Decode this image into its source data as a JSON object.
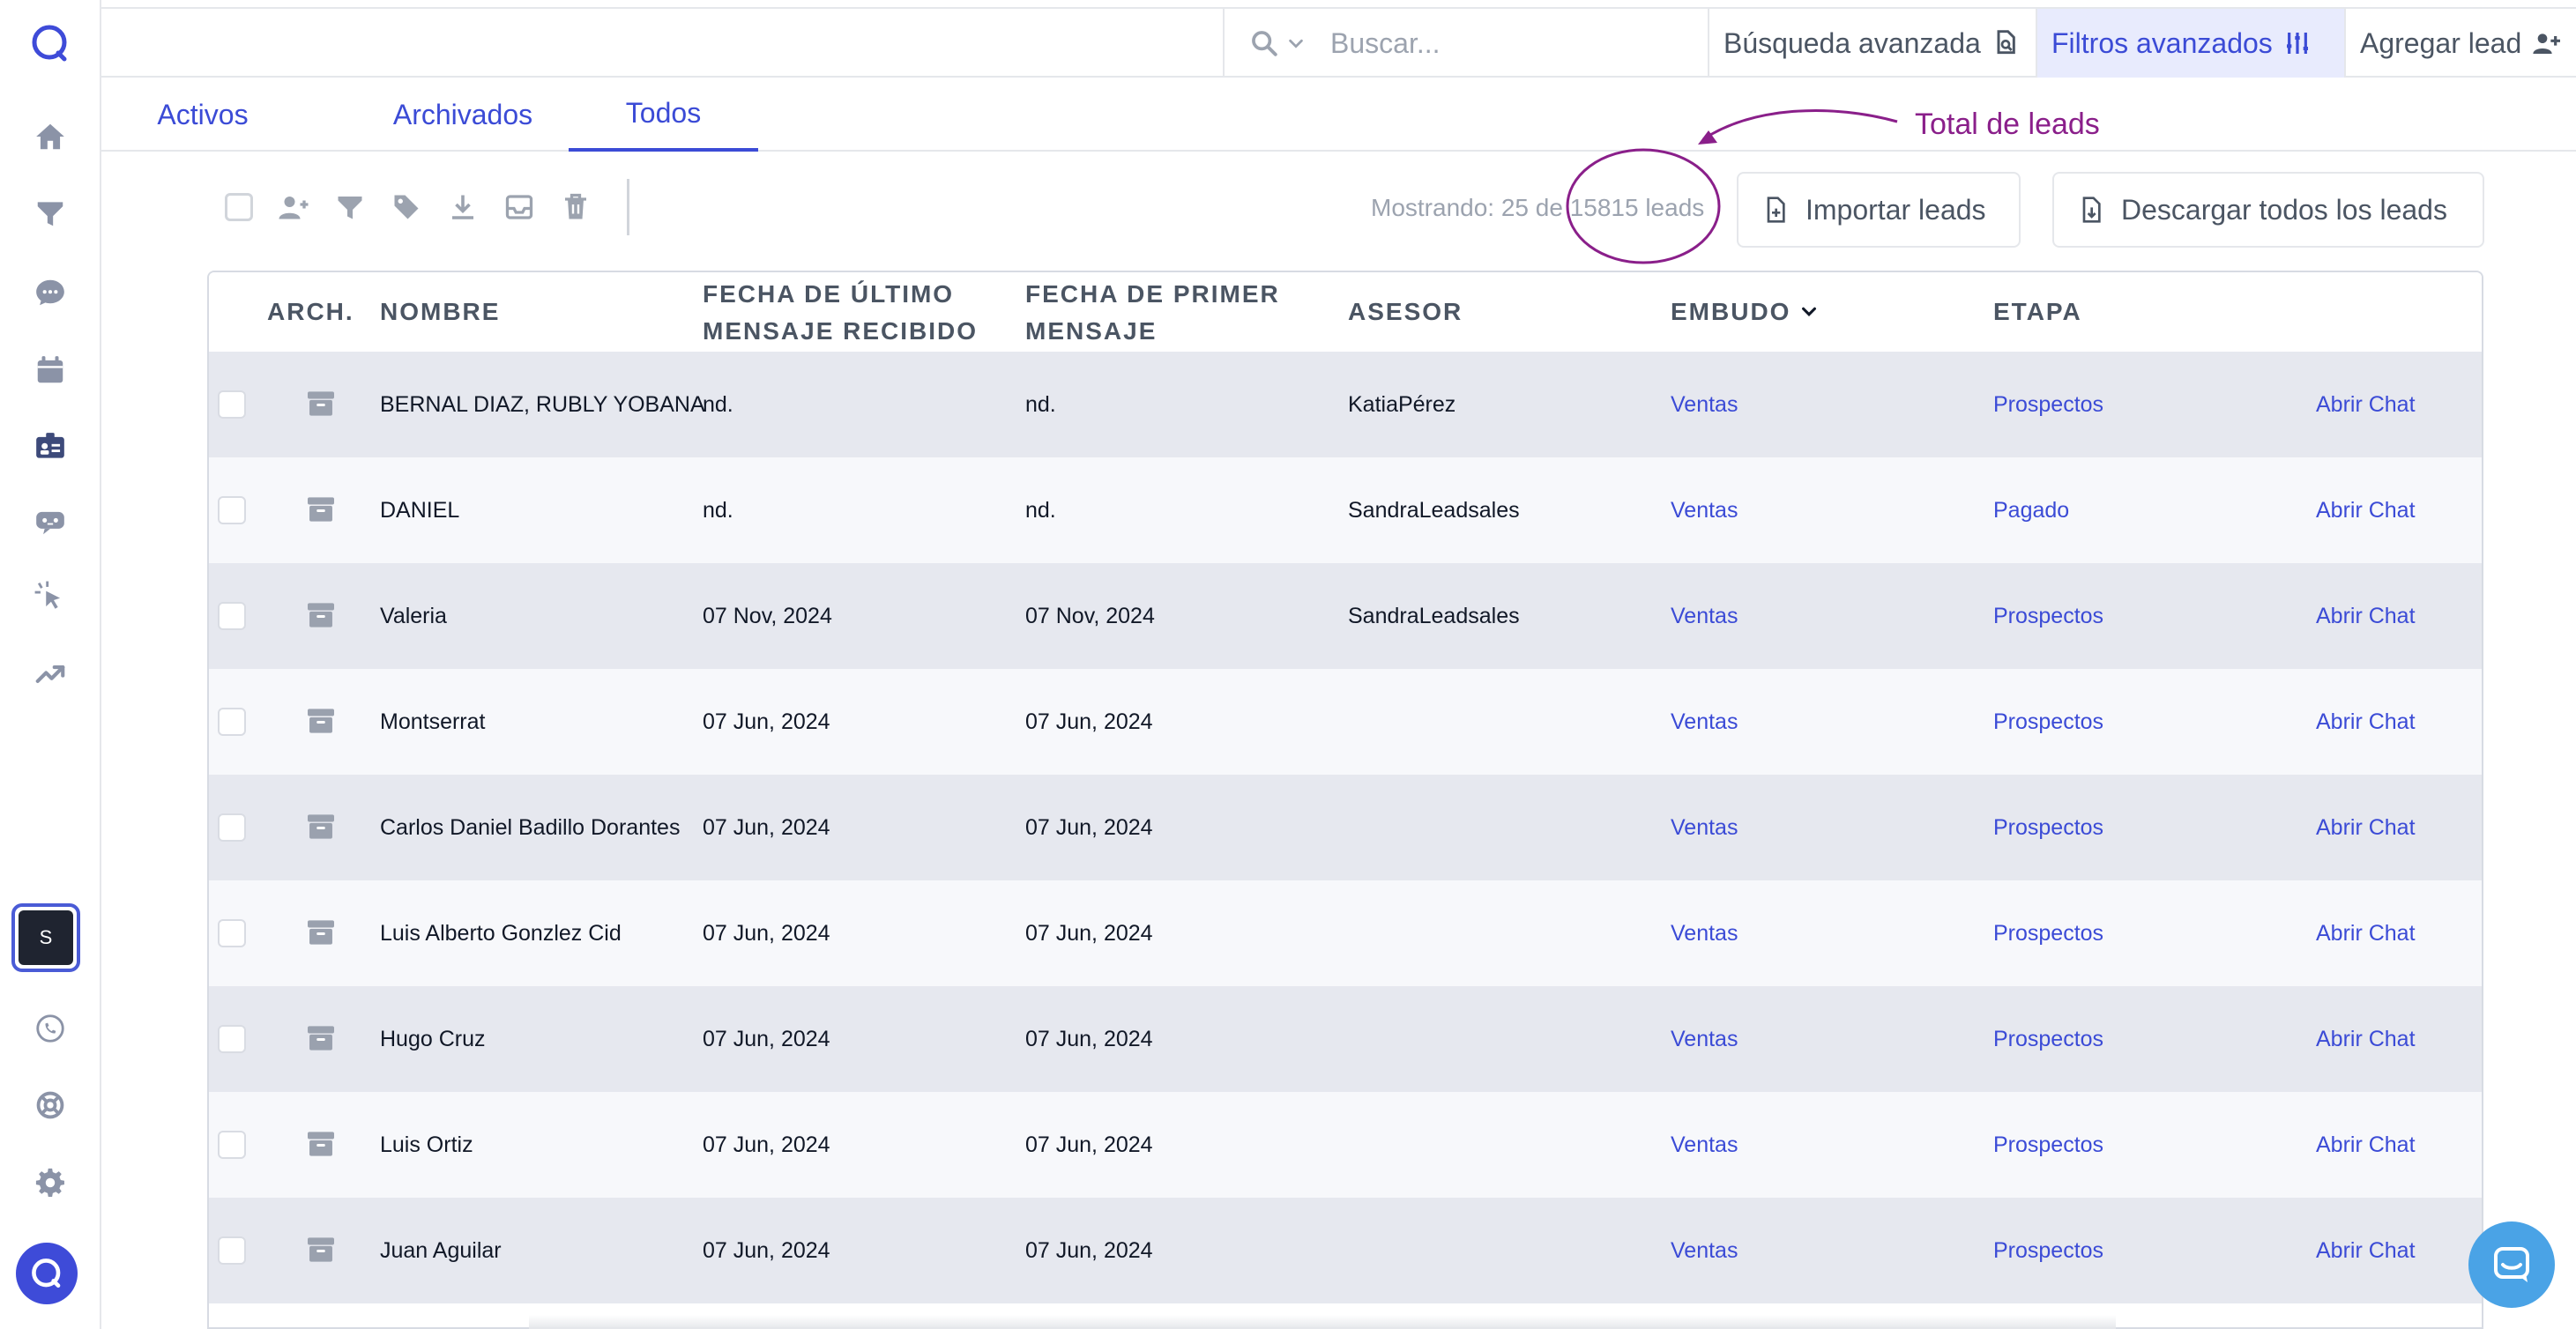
{
  "search": {
    "placeholder": "Buscar..."
  },
  "topbar": {
    "advanced_search": "Búsqueda avanzada",
    "advanced_filters": "Filtros avanzados",
    "add_lead": "Agregar lead"
  },
  "sidebar": {
    "user_initial": "S"
  },
  "tabs": [
    "Activos",
    "Archivados",
    "Todos"
  ],
  "active_tab": "Todos",
  "summary": {
    "showing": "Mostrando: 25 de 15815 leads"
  },
  "actions": {
    "import": "Importar leads",
    "download": "Descargar todos los leads"
  },
  "annotation": {
    "label": "Total de leads",
    "color": "#8a1f8a"
  },
  "table": {
    "headers": {
      "arch": "ARCH.",
      "name": "NOMBRE",
      "last_msg_line1": "FECHA DE ÚLTIMO",
      "last_msg_line2": "MENSAJE RECIBIDO",
      "first_msg_line1": "FECHA DE PRIMER",
      "first_msg_line2": "MENSAJE",
      "advisor": "ASESOR",
      "funnel": "EMBUDO",
      "stage": "ETAPA"
    },
    "rows": [
      {
        "name": "BERNAL DIAZ, RUBLY YOBANA",
        "last": "nd.",
        "first": "nd.",
        "advisor": "KatiaPérez",
        "funnel": "Ventas",
        "stage": "Prospectos",
        "action": "Abrir Chat"
      },
      {
        "name": "DANIEL",
        "last": "nd.",
        "first": "nd.",
        "advisor": "SandraLeadsales",
        "funnel": "Ventas",
        "stage": "Pagado",
        "action": "Abrir Chat"
      },
      {
        "name": "Valeria",
        "last": "07 Nov, 2024",
        "first": "07 Nov, 2024",
        "advisor": "SandraLeadsales",
        "funnel": "Ventas",
        "stage": "Prospectos",
        "action": "Abrir Chat"
      },
      {
        "name": "Montserrat",
        "last": "07 Jun, 2024",
        "first": "07 Jun, 2024",
        "advisor": "",
        "funnel": "Ventas",
        "stage": "Prospectos",
        "action": "Abrir Chat"
      },
      {
        "name": "Carlos Daniel Badillo Dorantes",
        "last": "07 Jun, 2024",
        "first": "07 Jun, 2024",
        "advisor": "",
        "funnel": "Ventas",
        "stage": "Prospectos",
        "action": "Abrir Chat"
      },
      {
        "name": "Luis Alberto Gonzlez Cid",
        "last": "07 Jun, 2024",
        "first": "07 Jun, 2024",
        "advisor": "",
        "funnel": "Ventas",
        "stage": "Prospectos",
        "action": "Abrir Chat"
      },
      {
        "name": "Hugo Cruz",
        "last": "07 Jun, 2024",
        "first": "07 Jun, 2024",
        "advisor": "",
        "funnel": "Ventas",
        "stage": "Prospectos",
        "action": "Abrir Chat"
      },
      {
        "name": "Luis Ortiz",
        "last": "07 Jun, 2024",
        "first": "07 Jun, 2024",
        "advisor": "",
        "funnel": "Ventas",
        "stage": "Prospectos",
        "action": "Abrir Chat"
      },
      {
        "name": "Juan Aguilar",
        "last": "07 Jun, 2024",
        "first": "07 Jun, 2024",
        "advisor": "",
        "funnel": "Ventas",
        "stage": "Prospectos",
        "action": "Abrir Chat"
      }
    ]
  }
}
